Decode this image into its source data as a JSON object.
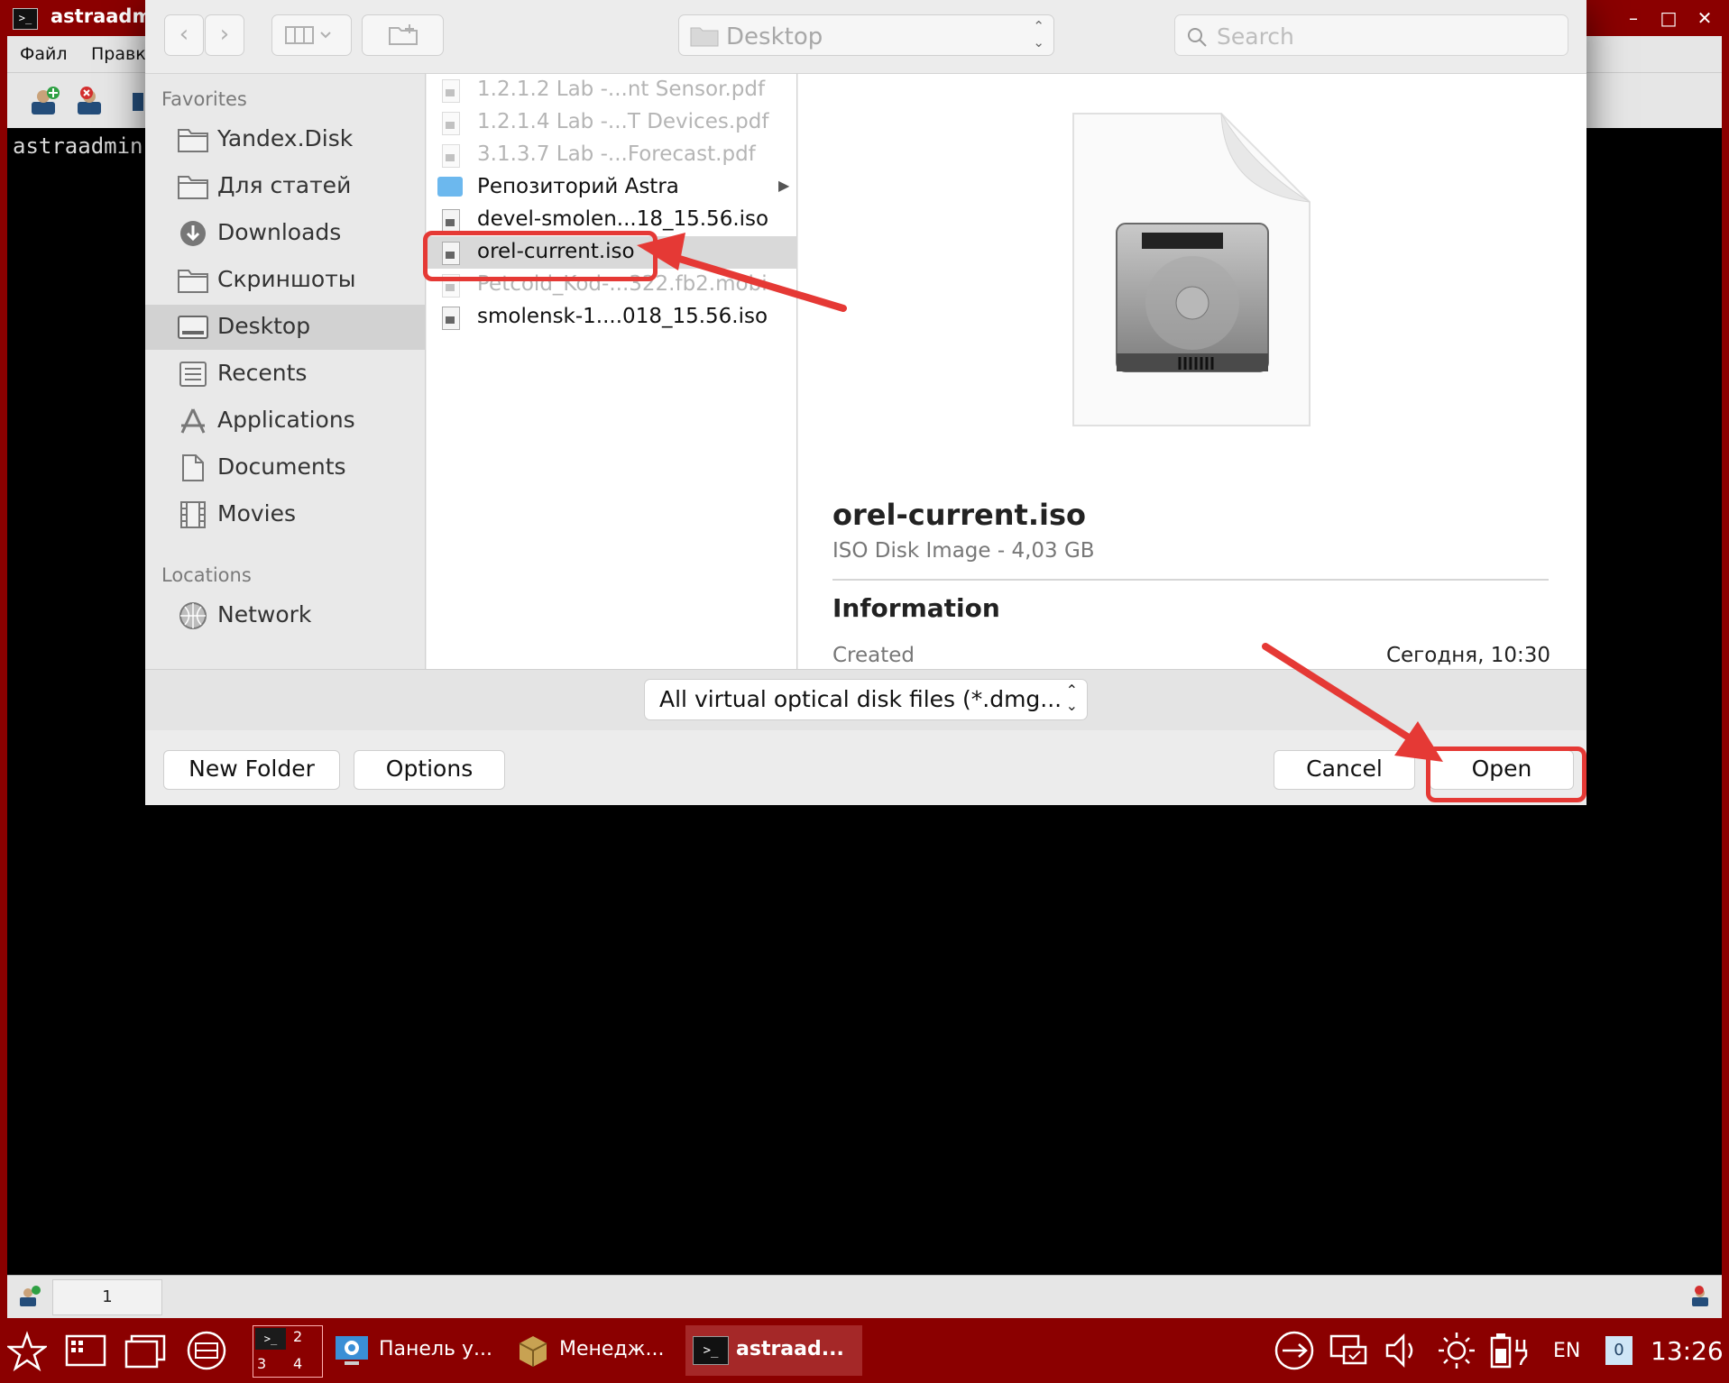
{
  "window": {
    "title": "astraadmin",
    "icon": "terminal-icon",
    "menu": [
      "Файл",
      "Правка"
    ],
    "terminal_text": "astraadmin",
    "status_number": "1"
  },
  "taskbar": {
    "workspaces": [
      "2",
      "3",
      "4"
    ],
    "apps": [
      {
        "label": "Панель у...",
        "icon": "control-panel-icon"
      },
      {
        "label": "Менедж...",
        "icon": "package-manager-icon"
      },
      {
        "label": "astraad...",
        "icon": "terminal-icon"
      }
    ],
    "language": "EN",
    "notification_count": "0",
    "clock": "13:26"
  },
  "dialog": {
    "location": "Desktop",
    "search_placeholder": "Search",
    "sidebar": {
      "favorites_title": "Favorites",
      "favorites": [
        {
          "label": "Yandex.Disk",
          "icon": "folder-icon"
        },
        {
          "label": "Для статей",
          "icon": "folder-icon"
        },
        {
          "label": "Downloads",
          "icon": "downloads-icon"
        },
        {
          "label": "Скриншоты",
          "icon": "folder-icon"
        },
        {
          "label": "Desktop",
          "icon": "desktop-icon",
          "selected": true
        },
        {
          "label": "Recents",
          "icon": "recents-icon"
        },
        {
          "label": "Applications",
          "icon": "applications-icon"
        },
        {
          "label": "Documents",
          "icon": "documents-icon"
        },
        {
          "label": "Movies",
          "icon": "movies-icon"
        }
      ],
      "locations_title": "Locations",
      "locations": [
        {
          "label": "Network",
          "icon": "network-icon"
        }
      ]
    },
    "files": [
      {
        "name": "1.2.1.2 Lab -...nt Sensor.pdf",
        "kind": "file",
        "dim": true
      },
      {
        "name": "1.2.1.4 Lab -...T Devices.pdf",
        "kind": "file",
        "dim": true
      },
      {
        "name": "3.1.3.7 Lab -...Forecast.pdf",
        "kind": "file",
        "dim": true
      },
      {
        "name": "Репозиторий Astra",
        "kind": "folder",
        "dim": false
      },
      {
        "name": "devel-smolen...18_15.56.iso",
        "kind": "file",
        "dim": false
      },
      {
        "name": "orel-current.iso",
        "kind": "file",
        "dim": false,
        "selected": true
      },
      {
        "name": "Petcold_Kod-...322.fb2.mobi",
        "kind": "file",
        "dim": true
      },
      {
        "name": "smolensk-1....018_15.56.iso",
        "kind": "file",
        "dim": false
      }
    ],
    "preview": {
      "name": "orel-current.iso",
      "kind": "ISO Disk Image - 4,03 GB",
      "info_title": "Information",
      "created_label": "Created",
      "created_value": "Сегодня, 10:30"
    },
    "filter": "All virtual optical disk files (*.dmg...",
    "buttons": {
      "new_folder": "New Folder",
      "options": "Options",
      "cancel": "Cancel",
      "open": "Open"
    },
    "accent_color": "#e53935"
  }
}
